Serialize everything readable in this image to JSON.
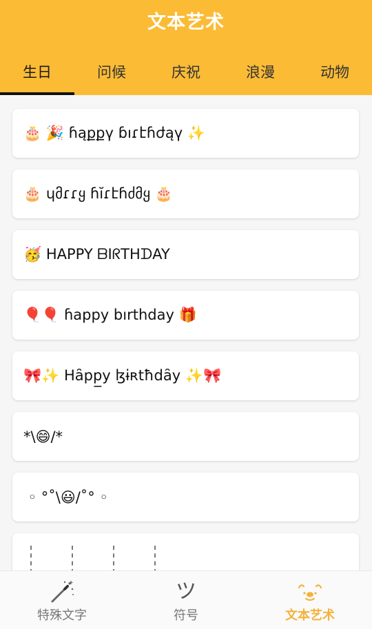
{
  "app": {
    "title": "文本艺术"
  },
  "tabs": [
    {
      "label": "生日",
      "active": true
    },
    {
      "label": "问候",
      "active": false
    },
    {
      "label": "庆祝",
      "active": false
    },
    {
      "label": "浪漫",
      "active": false
    },
    {
      "label": "动物",
      "active": false
    }
  ],
  "items": [
    {
      "text": "🎂 🎉 ɦąքքү ɓıɾէɦժąү ✨"
    },
    {
      "text": "🎂 ɥმɾɾყ ɦĭɾէɦძმყ 🎂"
    },
    {
      "text": "🥳 HAPPY ᗷIᖇTHᗪAY"
    },
    {
      "text": "🎈🎈 ɦappy bırthday 🎁"
    },
    {
      "text": "🎀✨ Hȃpp̲y ɮɨʀtħdȃy ✨🎀"
    },
    {
      "text": "*\\😄/*"
    },
    {
      "text": " ◦ °˚\\😃/˚° ◦"
    },
    {
      "text": ""
    }
  ],
  "bottom_nav": [
    {
      "label": "特殊文字",
      "icon": "magic-wand-icon",
      "active": false
    },
    {
      "label": "符号",
      "icon": "tsu-symbol-icon",
      "glyph": "ツ",
      "active": false
    },
    {
      "label": "文本艺术",
      "icon": "face-art-icon",
      "active": true
    }
  ],
  "colors": {
    "accent": "#fbbb35",
    "active_nav": "#f5b13a"
  }
}
